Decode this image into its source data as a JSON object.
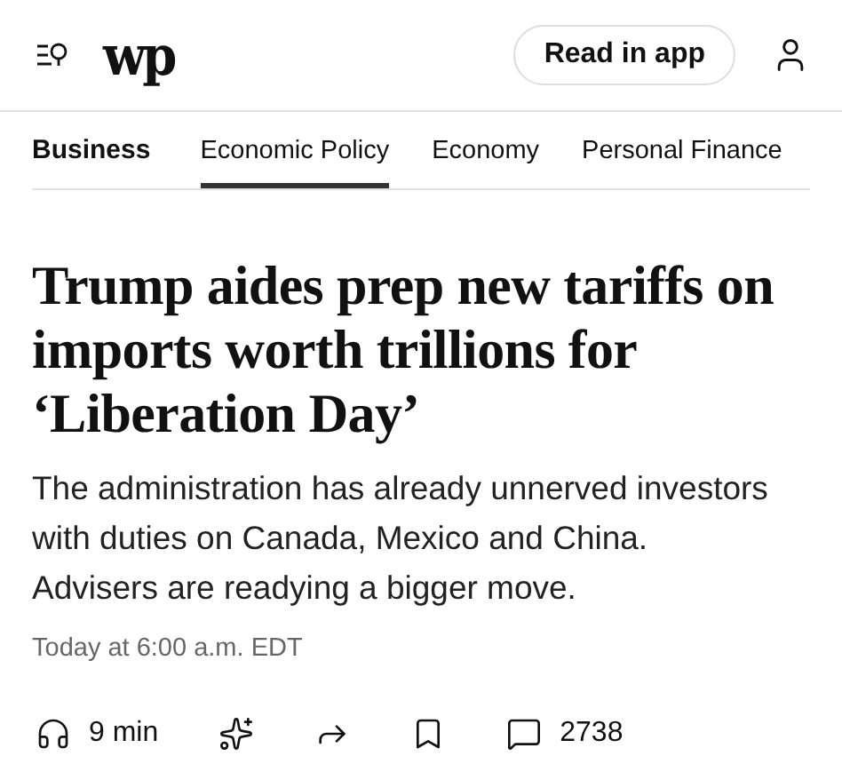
{
  "header": {
    "logo": "wp",
    "read_button": "Read in app"
  },
  "nav": {
    "section": "Business",
    "tabs": [
      {
        "label": "Economic Policy",
        "selected": true
      },
      {
        "label": "Economy",
        "selected": false
      },
      {
        "label": "Personal Finance",
        "selected": false
      }
    ]
  },
  "article": {
    "headline": "Trump aides prep new tariffs on imports worth trillions for ‘Liberation Day’",
    "summary": "The administration has already unnerved investors with duties on Canada, Mexico and China. Advisers are readying a bigger move.",
    "timestamp": "Today at 6:00 a.m. EDT"
  },
  "actions": [
    {
      "kind": "listen",
      "label": "9 min"
    },
    {
      "kind": "summary"
    },
    {
      "kind": "share"
    },
    {
      "kind": "save"
    },
    {
      "kind": "comments",
      "label": "2738"
    }
  ]
}
